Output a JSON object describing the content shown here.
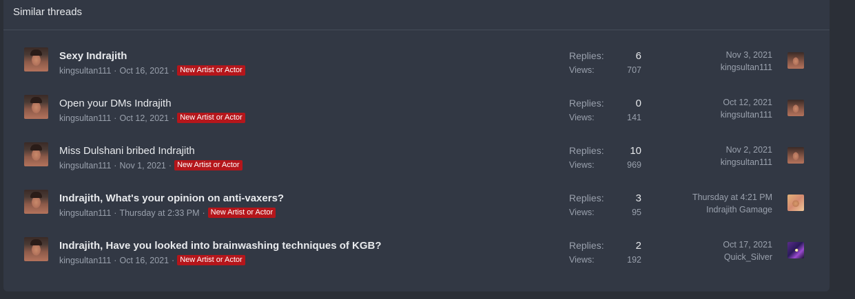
{
  "block": {
    "title": "Similar threads"
  },
  "threads": [
    {
      "title": "Sexy Indrajith",
      "author": "kingsultan111",
      "date": "Oct 16, 2021",
      "prefix": "New Artist or Actor",
      "replies_label": "Replies:",
      "replies": "6",
      "views_label": "Views:",
      "views": "707",
      "last_date": "Nov 3, 2021",
      "last_user": "kingsultan111"
    },
    {
      "title": "Open your DMs Indrajith",
      "author": "kingsultan111",
      "date": "Oct 12, 2021",
      "prefix": "New Artist or Actor",
      "replies_label": "Replies:",
      "replies": "0",
      "views_label": "Views:",
      "views": "141",
      "last_date": "Oct 12, 2021",
      "last_user": "kingsultan111"
    },
    {
      "title": "Miss Dulshani bribed Indrajith",
      "author": "kingsultan111",
      "date": "Nov 1, 2021",
      "prefix": "New Artist or Actor",
      "replies_label": "Replies:",
      "replies": "10",
      "views_label": "Views:",
      "views": "969",
      "last_date": "Nov 2, 2021",
      "last_user": "kingsultan111"
    },
    {
      "title": "Indrajith, What's your opinion on anti-vaxers?",
      "author": "kingsultan111",
      "date": "Thursday at 2:33 PM",
      "prefix": "New Artist or Actor",
      "replies_label": "Replies:",
      "replies": "3",
      "views_label": "Views:",
      "views": "95",
      "last_date": "Thursday at 4:21 PM",
      "last_user": "Indrajith Gamage"
    },
    {
      "title": "Indrajith, Have you looked into brainwashing techniques of KGB?",
      "author": "kingsultan111",
      "date": "Oct 16, 2021",
      "prefix": "New Artist or Actor",
      "replies_label": "Replies:",
      "replies": "2",
      "views_label": "Views:",
      "views": "192",
      "last_date": "Oct 17, 2021",
      "last_user": "Quick_Silver"
    }
  ],
  "separator": "·"
}
